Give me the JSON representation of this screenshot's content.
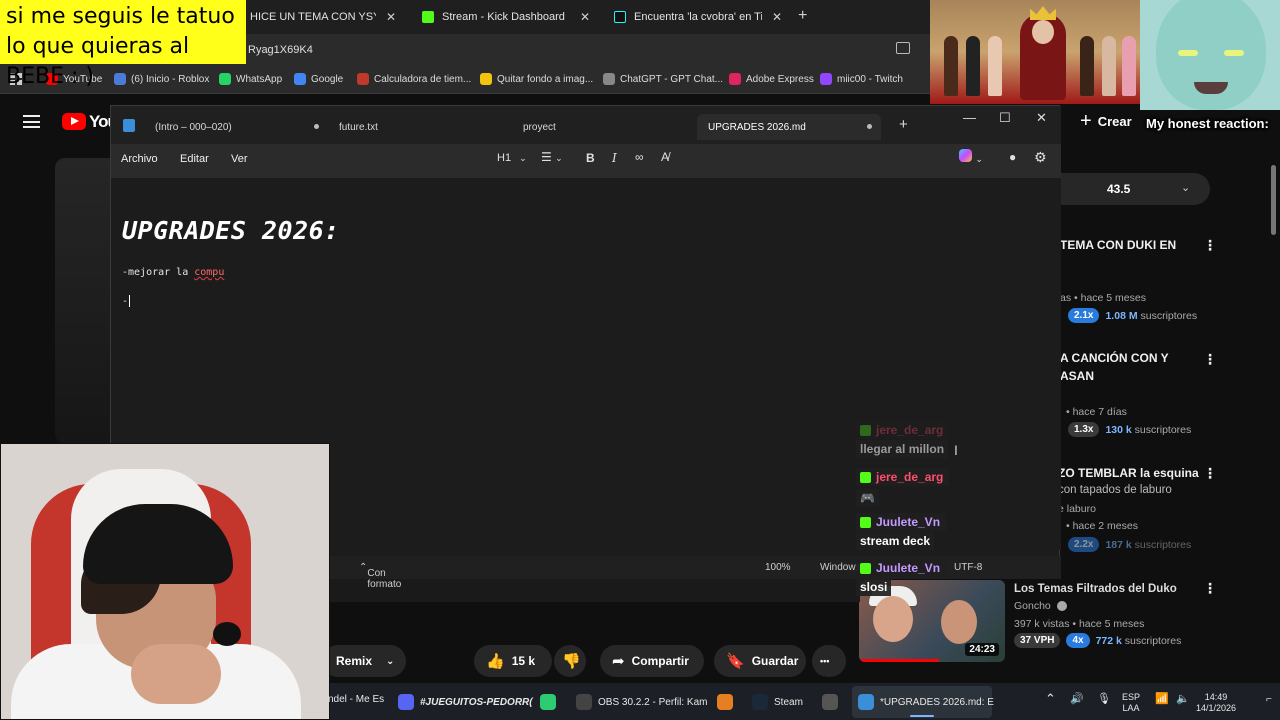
{
  "overlay": {
    "text": "si me seguis le tatuo lo que quieras al BEBE : )"
  },
  "browser": {
    "tabs": [
      {
        "label": "HICE UN TEMA CON YSY A - Yo",
        "close": "✕"
      },
      {
        "label": "Stream - Kick Dashboard",
        "close": "✕"
      },
      {
        "label": "Encuentra 'la cvobra' en TikTok",
        "close": "✕"
      }
    ],
    "new_tab": "+",
    "url": "Ryag1X69K4",
    "bookmarks": [
      {
        "label": "YouTube",
        "color": "#ff0000"
      },
      {
        "label": "(6) Inicio - Roblox",
        "color": "#4a7bd8"
      },
      {
        "label": "WhatsApp",
        "color": "#25d366"
      },
      {
        "label": "Google",
        "color": "#4285f4"
      },
      {
        "label": "Calculadora de tiem...",
        "color": "#c0392b"
      },
      {
        "label": "Quitar fondo a imag...",
        "color": "#f1c40f"
      },
      {
        "label": "ChatGPT - GPT Chat...",
        "color": "#888888"
      },
      {
        "label": "Adobe Express",
        "color": "#e0245e"
      },
      {
        "label": "miic00 - Twitch",
        "color": "#9146ff"
      }
    ]
  },
  "youtube": {
    "logo_text": "You",
    "create": "Crear",
    "speed": "43.5",
    "related": [
      {
        "title": "TEMA CON DUKI EN",
        "meta": "as • hace 5 meses",
        "pill": "2.1x",
        "subs": "1.08 M",
        "subs_label": "suscriptores"
      },
      {
        "title": "A CANCIÓN CON Y ASAN",
        "meta": "• hace 7 días",
        "pill": "1.3x",
        "subs": "130 k",
        "subs_label": "suscriptores"
      },
      {
        "title": "ZO TEMBLAR la esquina",
        "line2": "con tapados de laburo",
        "channel": "e laburo",
        "meta": "• hace 2 meses",
        "pill": "2.2x",
        "subs": "187 k",
        "subs_label": "suscriptores"
      },
      {
        "title": "Los Temas Filtrados del Duko",
        "channel": "Goncho",
        "meta": "397 k vistas • hace 5 meses",
        "vph": "37 VPH",
        "pill": "4x",
        "subs": "772 k",
        "subs_label": "suscriptores",
        "duration": "24:23"
      }
    ],
    "actions": {
      "remix": "Remix",
      "likes": "15 k",
      "share": "Compartir",
      "save": "Guardar",
      "more": "•••"
    }
  },
  "notepad": {
    "tabs": [
      {
        "label": "(Intro – 000–020)"
      },
      {
        "label": "future.txt"
      },
      {
        "label": "proyect"
      },
      {
        "label": "UPGRADES 2026.md"
      }
    ],
    "menu": [
      "Archivo",
      "Editar",
      "Ver"
    ],
    "heading_selector": "H1",
    "heading": "UPGRADES 2026:",
    "line1_prefix": "-mejorar la ",
    "line1_err": "compu",
    "line2": "-",
    "status": {
      "format": "Con formato",
      "zoom": "100%",
      "eol": "Windows",
      "encoding": "UTF-8"
    },
    "window_controls": {
      "minimize": "—",
      "maximize": "☐",
      "close": "✕"
    }
  },
  "chat": [
    {
      "user": "jere_de_arg",
      "color": "#ff4d6d",
      "faded": true
    },
    {
      "msg": "llegar al millon"
    },
    {
      "user": "jere_de_arg",
      "color": "#ff4d6d"
    },
    {
      "msg": "🎮"
    },
    {
      "user": "Juulete_Vn",
      "color": "#c39bff"
    },
    {
      "msg": "stream deck"
    },
    {
      "user": "Juulete_Vn",
      "color": "#c39bff"
    },
    {
      "msg": "slosi"
    }
  ],
  "reaction": "My honest reaction:",
  "taskbar": {
    "items": [
      {
        "label": "ndel - Me Es",
        "color": "#000000"
      },
      {
        "label": "#JUEGUITOS-PEDORR(",
        "color": "#5865f2"
      },
      {
        "label": "",
        "color": "#2ecc71"
      },
      {
        "label": "OBS 30.2.2 - Perfil: Kam",
        "color": "#444444"
      },
      {
        "label": "",
        "color": "#e67e22"
      },
      {
        "label": "Steam",
        "color": "#1b2838"
      },
      {
        "label": "",
        "color": "#555555"
      },
      {
        "label": "*UPGRADES 2026.md: E",
        "color": "#3b8ed8"
      }
    ],
    "lang": "ESP",
    "lang2": "LAA",
    "time": "14:49",
    "date": "14/1/2026"
  },
  "colors": {
    "accent": "#3b8ed8",
    "kick_green": "#53fc18",
    "youtube_red": "#ff0000"
  }
}
